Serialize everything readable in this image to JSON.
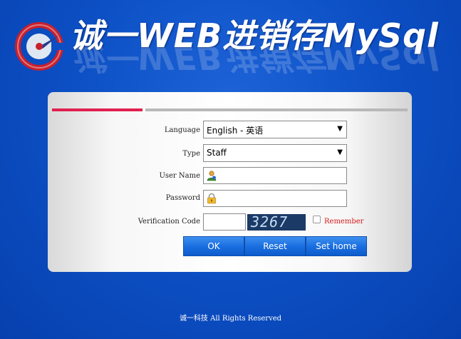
{
  "header": {
    "title": "诚一WEB进销存MySql",
    "brand_color": "#c8202c"
  },
  "form": {
    "language": {
      "label": "Language",
      "value": "English - 英语"
    },
    "type": {
      "label": "Type",
      "value": "Staff"
    },
    "username": {
      "label": "User Name",
      "value": ""
    },
    "password": {
      "label": "Password",
      "value": ""
    },
    "verification": {
      "label": "Verification Code",
      "value": "",
      "captcha_text": "3267"
    },
    "remember_label": "Remember"
  },
  "buttons": {
    "ok": "OK",
    "reset": "Reset",
    "sethome": "Set home"
  },
  "footer": {
    "text": "诚一科技  All Rights Reserved"
  },
  "icons": {
    "logo": "logo-icon",
    "user": "user-icon",
    "lock": "lock-icon",
    "dropdown": "chevron-down-icon"
  }
}
